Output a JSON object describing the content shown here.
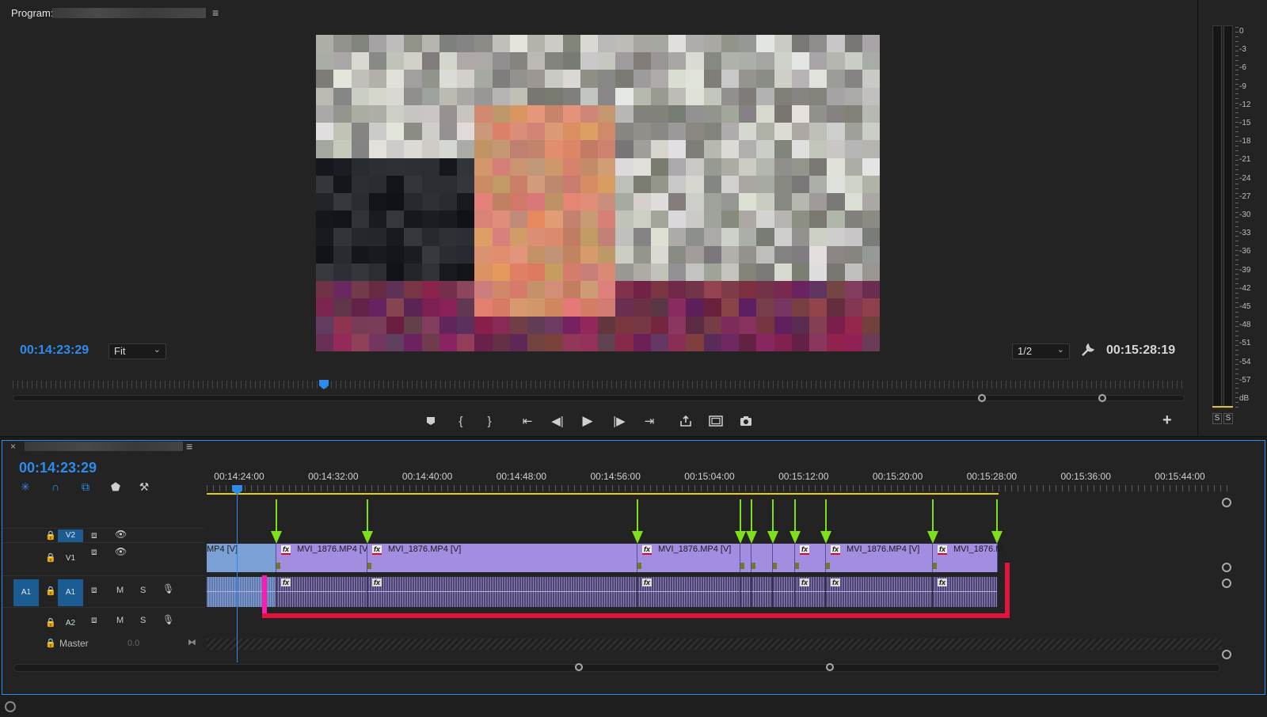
{
  "program_monitor": {
    "title": "Program:",
    "timecode_current": "00:14:23:29",
    "timecode_duration": "00:15:28:19",
    "zoom": "Fit",
    "resolution": "1/2"
  },
  "audio_meter": {
    "scale": [
      "0",
      "-3",
      "-6",
      "-9",
      "-12",
      "-15",
      "-18",
      "-21",
      "-24",
      "-27",
      "-30",
      "-33",
      "-36",
      "-39",
      "-42",
      "-45",
      "-48",
      "-51",
      "-54",
      "-57",
      "dB"
    ],
    "solo_left": "S",
    "solo_right": "S"
  },
  "timeline": {
    "timecode": "00:14:23:29",
    "ruler": [
      "00:14:24:00",
      "00:14:32:00",
      "00:14:40:00",
      "00:14:48:00",
      "00:14:56:00",
      "00:15:04:00",
      "00:15:12:00",
      "00:15:20:00",
      "00:15:28:00",
      "00:15:36:00",
      "00:15:44:00"
    ],
    "tracks": {
      "v2": "V2",
      "v1": "V1",
      "a1_source": "A1",
      "a1": "A1",
      "a2": "A2",
      "mute": "M",
      "solo": "S",
      "master": "Master",
      "master_level": "0.0"
    },
    "clips": {
      "first": "MP4 [V]",
      "c1": "MVI_1876.MP4 [V]",
      "c2": "MVI_1876.MP4 [V]",
      "c3": "MVI_1876.MP4 [V]",
      "c4": "MVI_1876.MP4 [V]",
      "c5": "MVI_1876.M"
    },
    "fx_label": "fx"
  },
  "colors": {
    "accent_blue": "#2d8ceb",
    "video_clip": "#a28de0",
    "audio_clip": "#4e4670",
    "annotation_arrow": "#7ee01b",
    "annotation_bracket": "#e2133c",
    "work_area": "#e8d000"
  }
}
